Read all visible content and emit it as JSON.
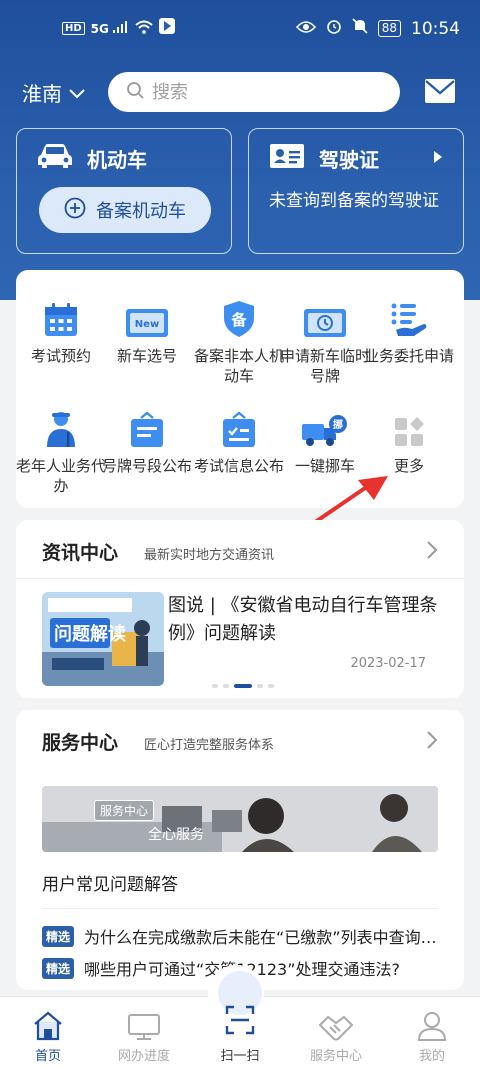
{
  "status_bar": {
    "time": "10:54",
    "network": "5G",
    "hd": "HD",
    "battery": "88"
  },
  "header": {
    "city": "淮南",
    "search_placeholder": "搜索",
    "mail_icon": "mail-icon"
  },
  "vehicle_card": {
    "title": "机动车",
    "register_button": "备案机动车"
  },
  "license_card": {
    "title": "驾驶证",
    "status": "未查询到备案的驾驶证"
  },
  "services": [
    {
      "label": "考试预约",
      "icon": "calendar-icon"
    },
    {
      "label": "新车选号",
      "icon": "new-plate-icon"
    },
    {
      "label": "备案非本人机动车",
      "icon": "shield-register-icon"
    },
    {
      "label": "申请新车临时号牌",
      "icon": "temp-plate-icon"
    },
    {
      "label": "业务委托申请",
      "icon": "delegate-icon"
    },
    {
      "label": "老年人业务代办",
      "icon": "elderly-icon"
    },
    {
      "label": "号牌号段公布",
      "icon": "plate-notice-icon"
    },
    {
      "label": "考试信息公布",
      "icon": "exam-notice-icon"
    },
    {
      "label": "一键挪车",
      "icon": "move-car-icon"
    },
    {
      "label": "更多",
      "icon": "more-grid-icon"
    }
  ],
  "news": {
    "title": "资讯中心",
    "subtitle": "最新实时地方交通资讯",
    "headline": "图说 | 《安徽省电动自行车管理条例》问题解读",
    "date": "2023-02-17",
    "thumb_caption": "问题解读"
  },
  "service_center": {
    "title": "服务中心",
    "subtitle": "匠心打造完整服务体系",
    "banner_tag": "服务中心",
    "banner_text": "全心服务",
    "faq_title": "用户常见问题解答",
    "faq_badge": "精选",
    "faqs": [
      "为什么在完成缴款后未能在“已缴款”列表中查询…",
      "哪些用户可通过“交管12123”处理交通违法?"
    ]
  },
  "tabbar": {
    "tabs": [
      {
        "label": "首页",
        "icon": "home-icon",
        "active": true
      },
      {
        "label": "网办进度",
        "icon": "monitor-icon",
        "active": false
      },
      {
        "label": "扫一扫",
        "icon": "scan-icon",
        "active": false
      },
      {
        "label": "服务中心",
        "icon": "handshake-icon",
        "active": false
      },
      {
        "label": "我的",
        "icon": "user-icon",
        "active": false
      }
    ]
  },
  "colors": {
    "brand_blue": "#1f4f9c",
    "accent_light_blue": "#dce9fb",
    "arrow_red": "#e8322d"
  }
}
